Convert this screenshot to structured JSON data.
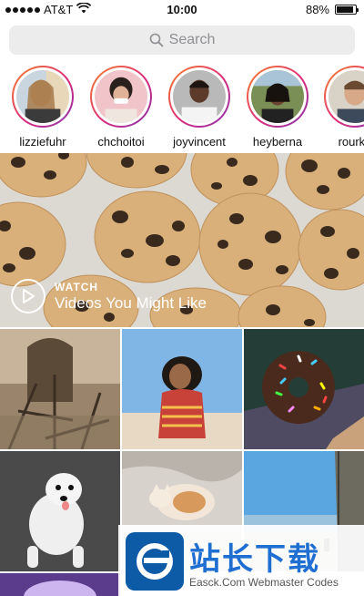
{
  "status_bar": {
    "carrier": "AT&T",
    "time": "10:00",
    "battery": "88%",
    "battery_level": 0.88,
    "signal_icon": "signal-dots-icon",
    "wifi_icon": "wifi-icon"
  },
  "search": {
    "placeholder": "Search",
    "icon": "search-icon"
  },
  "stories": [
    {
      "username": "lizziefuhr"
    },
    {
      "username": "chchoitoi"
    },
    {
      "username": "joyvincent"
    },
    {
      "username": "heyberna"
    },
    {
      "username": "rourke"
    }
  ],
  "video": {
    "eyebrow": "WATCH",
    "title": "Videos You Might Like",
    "icon": "play-icon"
  },
  "grid": [
    {
      "subject": "tree-shadow-photo"
    },
    {
      "subject": "beach-woman-photo"
    },
    {
      "subject": "sprinkled-donut-photo"
    },
    {
      "subject": "white-dog-photo"
    },
    {
      "subject": "sleeping-cat-photo"
    },
    {
      "subject": "coastal-road-photo"
    },
    {
      "subject": "purple-light-photo"
    }
  ],
  "watermark": {
    "main": "站长下载",
    "sub": "Easck.Com Webmaster Codes",
    "logo_icon": "easck-logo-icon"
  },
  "colors": {
    "story_ring_start": "#f58529",
    "story_ring_mid": "#dd2a7b",
    "story_ring_end": "#8134af",
    "search_bg": "#ececec",
    "watermark_blue": "#1e6fd1"
  }
}
